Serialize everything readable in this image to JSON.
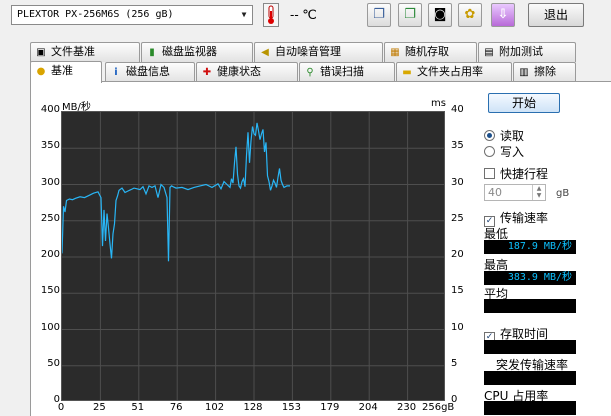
{
  "toolbar": {
    "drive": "PLEXTOR PX-256M6S (256 gB)",
    "temperature": "-- ℃",
    "exit_label": "退出"
  },
  "tabs_top": [
    {
      "label": "文件基准",
      "icon": "file-benchmark-icon"
    },
    {
      "label": "磁盘监视器",
      "icon": "disk-monitor-icon"
    },
    {
      "label": "自动噪音管理",
      "icon": "speaker-icon"
    },
    {
      "label": "随机存取",
      "icon": "random-access-icon"
    },
    {
      "label": "附加测试",
      "icon": "extra-tests-icon"
    }
  ],
  "tabs_bottom": [
    {
      "label": "基准",
      "icon": "bulb-icon",
      "active": true
    },
    {
      "label": "磁盘信息",
      "icon": "info-icon"
    },
    {
      "label": "健康状态",
      "icon": "health-cross-icon"
    },
    {
      "label": "错误扫描",
      "icon": "magnifier-icon"
    },
    {
      "label": "文件夹占用率",
      "icon": "folder-icon"
    },
    {
      "label": "擦除",
      "icon": "trash-icon"
    }
  ],
  "chart": {
    "left_unit": "MB/秒",
    "right_unit": "ms",
    "left_ticks": [
      "400",
      "350",
      "300",
      "250",
      "200",
      "150",
      "100",
      "50",
      "0"
    ],
    "right_ticks": [
      "40",
      "35",
      "30",
      "25",
      "20",
      "15",
      "10",
      "5",
      "0"
    ],
    "x_ticks": [
      "0",
      "25",
      "51",
      "76",
      "102",
      "128",
      "153",
      "179",
      "204",
      "230",
      "256gB"
    ]
  },
  "chart_data": {
    "type": "line",
    "xlabel": "",
    "ylabel": "MB/秒",
    "y2label": "ms",
    "xlim": [
      0,
      256
    ],
    "ylim": [
      0,
      400
    ],
    "y2lim": [
      0,
      40
    ],
    "grid": true,
    "series": [
      {
        "color": "#29b6f6",
        "x": [
          0,
          1,
          2,
          3,
          5,
          7,
          9,
          12,
          15,
          18,
          21,
          24,
          26,
          27,
          28,
          29,
          30,
          31,
          32,
          33,
          34,
          35,
          36,
          37,
          38,
          40,
          42,
          44,
          46,
          48,
          50,
          52,
          54,
          56,
          58,
          60,
          62,
          64,
          66,
          68,
          70,
          71,
          72,
          73,
          74,
          76,
          80,
          84,
          88,
          92,
          96,
          100,
          104,
          106,
          108,
          110,
          112,
          113,
          114,
          115,
          116,
          117,
          118,
          119,
          120,
          121,
          122,
          123,
          124,
          125,
          126,
          127,
          128,
          129,
          130,
          131,
          132,
          133,
          134,
          135,
          136,
          137,
          138,
          139,
          140,
          141,
          142,
          143,
          144,
          145,
          146,
          147,
          148,
          150,
          152
        ],
        "y": [
          205,
          270,
          262,
          278,
          280,
          279,
          281,
          283,
          282,
          285,
          288,
          290,
          282,
          215,
          265,
          222,
          260,
          240,
          218,
          198,
          232,
          246,
          278,
          284,
          292,
          295,
          289,
          291,
          293,
          295,
          294,
          293,
          297,
          287,
          298,
          296,
          298,
          282,
          300,
          296,
          282,
          194,
          296,
          298,
          297,
          295,
          296,
          293,
          296,
          298,
          300,
          296,
          301,
          294,
          304,
          300,
          296,
          308,
          302,
          330,
          352,
          314,
          298,
          295,
          304,
          308,
          297,
          340,
          372,
          330,
          360,
          380,
          370,
          368,
          385,
          374,
          362,
          370,
          376,
          345,
          358,
          312,
          304,
          292,
          298,
          306,
          302,
          296,
          310,
          322,
          306,
          300,
          296,
          298,
          298
        ]
      }
    ]
  },
  "panel": {
    "start_label": "开始",
    "read_label": "读取",
    "write_label": "写入",
    "short_stroke_label": "快捷行程",
    "short_stroke_value": "40",
    "short_stroke_unit": "gB",
    "transfer_rate_label": "传输速率",
    "min_label": "最低",
    "min_value": "187.9 MB/秒",
    "max_label": "最高",
    "max_value": "383.9 MB/秒",
    "avg_label": "平均",
    "access_time_label": "存取时间",
    "burst_rate_label": "突发传输速率",
    "cpu_label": "CPU 占用率"
  }
}
